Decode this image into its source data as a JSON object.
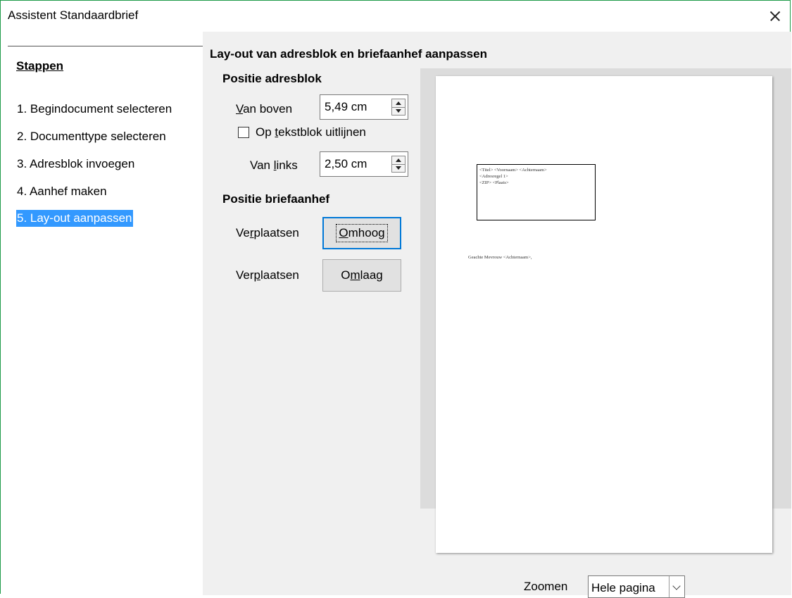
{
  "window": {
    "title": "Assistent Standaardbrief"
  },
  "steps": {
    "heading": "Stappen",
    "items": [
      {
        "label": "1. Begindocument selecteren",
        "active": false
      },
      {
        "label": "2. Documenttype selecteren",
        "active": false
      },
      {
        "label": "3. Adresblok invoegen",
        "active": false
      },
      {
        "label": "4. Aanhef maken",
        "active": false
      },
      {
        "label": "5. Lay-out aanpassen",
        "active": true
      }
    ]
  },
  "content": {
    "heading": "Lay-out van adresblok en briefaanhef aanpassen",
    "address_position": {
      "label": "Positie adresblok",
      "from_top": {
        "prefix": "V",
        "rest": "an boven",
        "value": "5,49 cm"
      },
      "align_checkbox": {
        "prefix": "Op ",
        "underlined": "t",
        "rest": "ekstblok uitlijnen",
        "checked": false
      },
      "from_left": {
        "prefix": "Van ",
        "underlined": "l",
        "rest": "inks",
        "value": "2,50 cm"
      }
    },
    "salutation_position": {
      "label": "Positie briefaanhef",
      "move_up": {
        "label_prefix": "Ve",
        "label_under": "r",
        "label_rest": "plaatsen",
        "button_under": "O",
        "button_rest": "mhoog"
      },
      "move_down": {
        "label_prefix": "Ver",
        "label_under": "p",
        "label_rest": "laatsen",
        "button_prefix": "O",
        "button_under": "m",
        "button_rest": "laag"
      }
    },
    "preview": {
      "address_lines": [
        "<Titel> <Voornaam> <Achternaam>",
        "<Adresregel 1>",
        "<ZIP> <Plaats>"
      ],
      "salutation": "Geachte Mevrouw <Achternaam>,"
    },
    "zoom": {
      "label": "Zoomen",
      "value": "Hele pagina"
    }
  },
  "colors": {
    "accent": "#3399ff",
    "focus_border": "#0078d7",
    "window_border": "#1e9a48"
  }
}
